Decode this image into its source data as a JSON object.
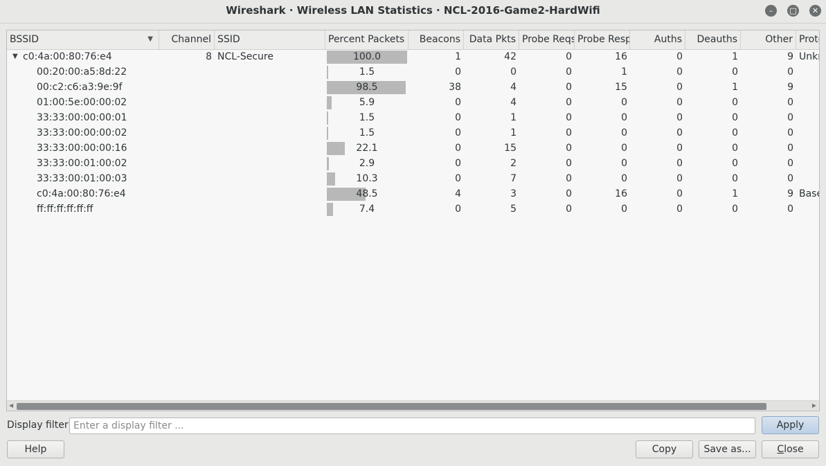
{
  "window": {
    "title": "Wireshark · Wireless LAN Statistics · NCL-2016-Game2-HardWifi",
    "minimize_icon": "–",
    "maximize_icon": "□",
    "close_icon": "✕"
  },
  "table": {
    "columns": [
      "BSSID",
      "Channel",
      "SSID",
      "Percent Packets",
      "Beacons",
      "Data Pkts",
      "Probe Reqs",
      "Probe Resp",
      "Auths",
      "Deauths",
      "Other",
      "Protocol"
    ],
    "column_headers_visible": [
      "BSSID",
      "Channel",
      "SSID",
      "Percent Packets",
      "Beacons",
      "Data Pkts",
      "Probe Reqs",
      "Probe Resp",
      "Auths",
      "Deauths",
      "Other",
      "Proto"
    ],
    "sort_indicator": "▼",
    "rows": [
      {
        "expander": "▼",
        "bssid": "c0:4a:00:80:76:e4",
        "channel": "8",
        "ssid": "NCL-Secure",
        "percent": "100.0",
        "percent_value": 100.0,
        "beacons": "1",
        "data": "42",
        "probe_reqs": "0",
        "probe_resp": "16",
        "auths": "0",
        "deauths": "1",
        "other": "9",
        "protocol": "Unkn"
      },
      {
        "expander": "",
        "bssid": "00:20:00:a5:8d:22",
        "channel": "",
        "ssid": "",
        "percent": "1.5",
        "percent_value": 1.5,
        "beacons": "0",
        "data": "0",
        "probe_reqs": "0",
        "probe_resp": "1",
        "auths": "0",
        "deauths": "0",
        "other": "0",
        "protocol": ""
      },
      {
        "expander": "",
        "bssid": "00:c2:c6:a3:9e:9f",
        "channel": "",
        "ssid": "",
        "percent": "98.5",
        "percent_value": 98.5,
        "beacons": "38",
        "data": "4",
        "probe_reqs": "0",
        "probe_resp": "15",
        "auths": "0",
        "deauths": "1",
        "other": "9",
        "protocol": ""
      },
      {
        "expander": "",
        "bssid": "01:00:5e:00:00:02",
        "channel": "",
        "ssid": "",
        "percent": "5.9",
        "percent_value": 5.9,
        "beacons": "0",
        "data": "4",
        "probe_reqs": "0",
        "probe_resp": "0",
        "auths": "0",
        "deauths": "0",
        "other": "0",
        "protocol": ""
      },
      {
        "expander": "",
        "bssid": "33:33:00:00:00:01",
        "channel": "",
        "ssid": "",
        "percent": "1.5",
        "percent_value": 1.5,
        "beacons": "0",
        "data": "1",
        "probe_reqs": "0",
        "probe_resp": "0",
        "auths": "0",
        "deauths": "0",
        "other": "0",
        "protocol": ""
      },
      {
        "expander": "",
        "bssid": "33:33:00:00:00:02",
        "channel": "",
        "ssid": "",
        "percent": "1.5",
        "percent_value": 1.5,
        "beacons": "0",
        "data": "1",
        "probe_reqs": "0",
        "probe_resp": "0",
        "auths": "0",
        "deauths": "0",
        "other": "0",
        "protocol": ""
      },
      {
        "expander": "",
        "bssid": "33:33:00:00:00:16",
        "channel": "",
        "ssid": "",
        "percent": "22.1",
        "percent_value": 22.1,
        "beacons": "0",
        "data": "15",
        "probe_reqs": "0",
        "probe_resp": "0",
        "auths": "0",
        "deauths": "0",
        "other": "0",
        "protocol": ""
      },
      {
        "expander": "",
        "bssid": "33:33:00:01:00:02",
        "channel": "",
        "ssid": "",
        "percent": "2.9",
        "percent_value": 2.9,
        "beacons": "0",
        "data": "2",
        "probe_reqs": "0",
        "probe_resp": "0",
        "auths": "0",
        "deauths": "0",
        "other": "0",
        "protocol": ""
      },
      {
        "expander": "",
        "bssid": "33:33:00:01:00:03",
        "channel": "",
        "ssid": "",
        "percent": "10.3",
        "percent_value": 10.3,
        "beacons": "0",
        "data": "7",
        "probe_reqs": "0",
        "probe_resp": "0",
        "auths": "0",
        "deauths": "0",
        "other": "0",
        "protocol": ""
      },
      {
        "expander": "",
        "bssid": "c0:4a:00:80:76:e4",
        "channel": "",
        "ssid": "",
        "percent": "48.5",
        "percent_value": 48.5,
        "beacons": "4",
        "data": "3",
        "probe_reqs": "0",
        "probe_resp": "16",
        "auths": "0",
        "deauths": "1",
        "other": "9",
        "protocol": "Base"
      },
      {
        "expander": "",
        "bssid": "ff:ff:ff:ff:ff:ff",
        "channel": "",
        "ssid": "",
        "percent": "7.4",
        "percent_value": 7.4,
        "beacons": "0",
        "data": "5",
        "probe_reqs": "0",
        "probe_resp": "0",
        "auths": "0",
        "deauths": "0",
        "other": "0",
        "protocol": ""
      }
    ]
  },
  "scrollbar": {
    "left_arrow": "◀",
    "right_arrow": "▶"
  },
  "filter": {
    "label": "Display filter:",
    "placeholder": "Enter a display filter ...",
    "value": ""
  },
  "buttons": {
    "apply": "Apply",
    "help": "Help",
    "copy": "Copy",
    "save_as": "Save as...",
    "close": "Close"
  },
  "colors": {
    "bar": "#b8b8b8",
    "background": "#e8e8e7",
    "table_bg": "#f7f7f7",
    "apply_button": "#bcd0e6"
  }
}
